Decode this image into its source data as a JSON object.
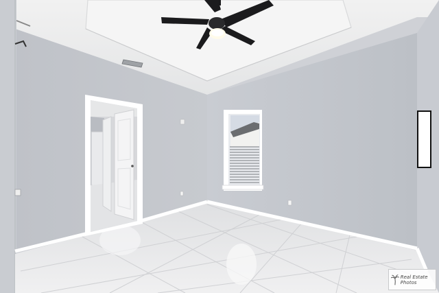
{
  "scene": {
    "kind": "photo",
    "subject": "empty-bedroom",
    "colors": {
      "wall": "#c3c6cc",
      "ceiling": "#eceded",
      "floor": "#e6e7e9",
      "trim": "#ffffff",
      "fan": "#1b1b1d"
    }
  },
  "watermark": {
    "text": "Real Estate Photos"
  }
}
